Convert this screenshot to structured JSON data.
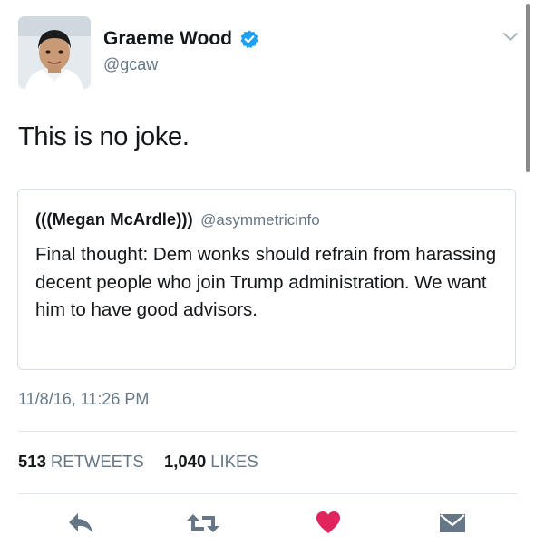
{
  "tweet": {
    "author": {
      "display_name": "Graeme Wood",
      "handle": "@gcaw",
      "verified_icon": "verified-badge-icon",
      "avatar": "profile-photo"
    },
    "menu_icon": "chevron-down-icon",
    "text": "This is no joke.",
    "quoted_tweet": {
      "display_name": "(((Megan McArdle)))",
      "handle": "@asymmetricinfo",
      "text": "Final thought: Dem wonks should refrain from harassing decent people who join Trump administration. We want him to have good advisors."
    },
    "timestamp": "11/8/16, 11:26 PM",
    "stats": {
      "retweets_count": "513",
      "retweets_label": "RETWEETS",
      "likes_count": "1,040",
      "likes_label": "LIKES"
    },
    "actions": [
      {
        "name": "reply",
        "icon": "reply-icon"
      },
      {
        "name": "retweet",
        "icon": "retweet-icon"
      },
      {
        "name": "like",
        "icon": "heart-icon"
      },
      {
        "name": "direct-message",
        "icon": "envelope-icon"
      }
    ]
  },
  "colors": {
    "verified_blue": "#1da1f2",
    "like_red": "#e0245e",
    "action_gray": "#657786",
    "text_primary": "#14171a",
    "text_secondary": "#657786",
    "border": "#e1e8ed"
  }
}
